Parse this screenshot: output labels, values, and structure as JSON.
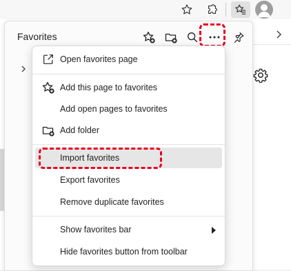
{
  "browser": {
    "toolbar_icons": [
      "star-icon",
      "extensions-icon",
      "favorites-icon",
      "avatar",
      "more-icon"
    ]
  },
  "favorites_panel": {
    "title": "Favorites",
    "header_buttons": [
      "add-favorite-icon",
      "add-folder-icon",
      "search-icon",
      "more-options-icon",
      "pin-icon"
    ]
  },
  "menu": {
    "items": [
      {
        "label": "Open favorites page",
        "icon": "open-external-icon"
      },
      {
        "label": "Add this page to favorites",
        "icon": "star-add-icon"
      },
      {
        "label": "Add open pages to favorites",
        "icon": ""
      },
      {
        "label": "Add folder",
        "icon": "folder-add-icon"
      },
      {
        "label": "Import favorites",
        "icon": ""
      },
      {
        "label": "Export favorites",
        "icon": ""
      },
      {
        "label": "Remove duplicate favorites",
        "icon": ""
      },
      {
        "label": "Show favorites bar",
        "icon": "",
        "submenu": true
      },
      {
        "label": "Hide favorites button from toolbar",
        "icon": ""
      }
    ],
    "highlighted": "Import favorites"
  },
  "colors": {
    "annotation": "#e8001e",
    "hover": "#e6e6e6"
  }
}
